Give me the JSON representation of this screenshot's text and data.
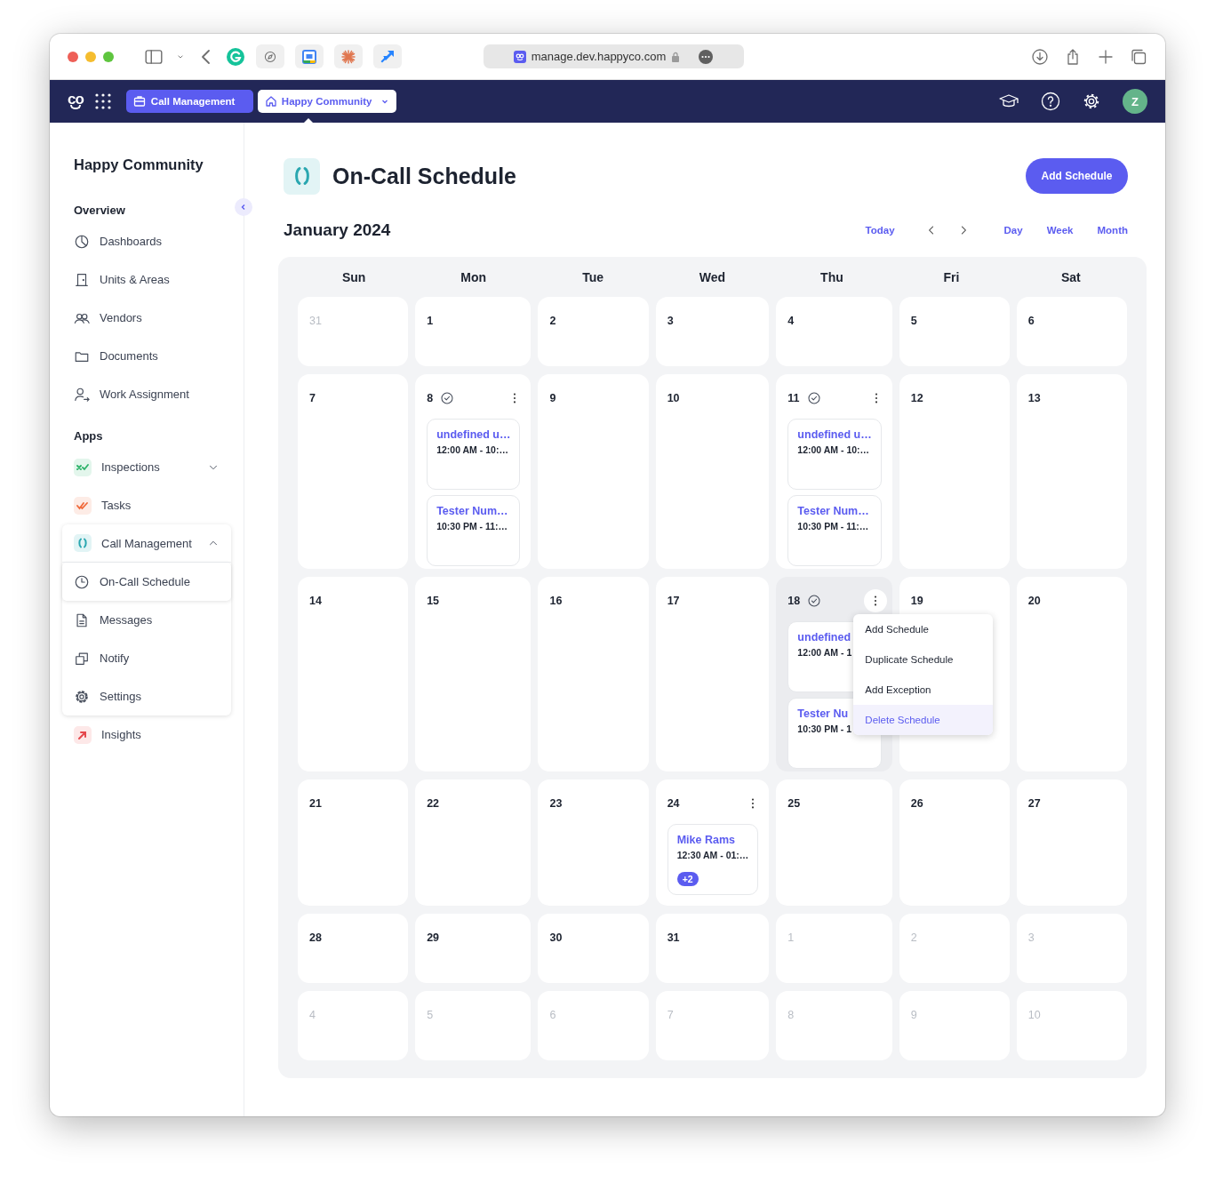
{
  "browser": {
    "url": "manage.dev.happyco.com"
  },
  "app_bar": {
    "logo": "co",
    "module": "Call Management",
    "property": "Happy Community",
    "avatar": "Z"
  },
  "sidebar": {
    "title": "Happy Community",
    "sections": [
      {
        "heading": "Overview",
        "items": [
          {
            "label": "Dashboards",
            "selected": false
          },
          {
            "label": "Units & Areas",
            "selected": false
          },
          {
            "label": "Vendors",
            "selected": false
          },
          {
            "label": "Documents",
            "selected": false
          },
          {
            "label": "Work Assignment",
            "selected": false
          }
        ]
      },
      {
        "heading": "Apps",
        "items": [
          {
            "label": "Inspections",
            "selected": false,
            "expanded": false
          },
          {
            "label": "Tasks",
            "selected": false
          },
          {
            "label": "Call Management",
            "selected": false,
            "expanded": true,
            "children": [
              {
                "label": "On-Call Schedule",
                "selected": true
              },
              {
                "label": "Messages",
                "selected": false
              },
              {
                "label": "Notify",
                "selected": false
              },
              {
                "label": "Settings",
                "selected": false
              }
            ]
          },
          {
            "label": "Insights",
            "selected": false
          }
        ]
      }
    ]
  },
  "page": {
    "title": "On-Call Schedule",
    "add_button": "Add Schedule"
  },
  "calendar": {
    "month": "January 2024",
    "today": "Today",
    "views": [
      "Day",
      "Week",
      "Month"
    ],
    "weekdays": [
      "Sun",
      "Mon",
      "Tue",
      "Wed",
      "Thu",
      "Fri",
      "Sat"
    ],
    "weeks": [
      [
        {
          "day": "31",
          "muted": true,
          "confirmed": false,
          "menu": false,
          "menu_open": false
        },
        {
          "day": "1",
          "muted": false,
          "confirmed": false,
          "menu": false,
          "menu_open": false
        },
        {
          "day": "2",
          "muted": false,
          "confirmed": false,
          "menu": false,
          "menu_open": false
        },
        {
          "day": "3",
          "muted": false,
          "confirmed": false,
          "menu": false,
          "menu_open": false
        },
        {
          "day": "4",
          "muted": false,
          "confirmed": false,
          "menu": false,
          "menu_open": false
        },
        {
          "day": "5",
          "muted": false,
          "confirmed": false,
          "menu": false,
          "menu_open": false
        },
        {
          "day": "6",
          "muted": false,
          "confirmed": false,
          "menu": false,
          "menu_open": false
        }
      ],
      [
        {
          "day": "7",
          "muted": false,
          "confirmed": false,
          "menu": false,
          "menu_open": false
        },
        {
          "day": "8",
          "muted": false,
          "confirmed": true,
          "menu": true,
          "menu_open": false,
          "events": [
            {
              "title": "undefined u…",
              "time": "12:00 AM - 10:…"
            },
            {
              "title": "Tester Num…",
              "time": "10:30 PM - 11:…"
            }
          ]
        },
        {
          "day": "9",
          "muted": false,
          "confirmed": false,
          "menu": false,
          "menu_open": false
        },
        {
          "day": "10",
          "muted": false,
          "confirmed": false,
          "menu": false,
          "menu_open": false
        },
        {
          "day": "11",
          "muted": false,
          "confirmed": true,
          "menu": true,
          "menu_open": false,
          "events": [
            {
              "title": "undefined u…",
              "time": "12:00 AM - 10:…"
            },
            {
              "title": "Tester Num…",
              "time": "10:30 PM - 11:…"
            }
          ]
        },
        {
          "day": "12",
          "muted": false,
          "confirmed": false,
          "menu": false,
          "menu_open": false
        },
        {
          "day": "13",
          "muted": false,
          "confirmed": false,
          "menu": false,
          "menu_open": false
        }
      ],
      [
        {
          "day": "14",
          "muted": false,
          "confirmed": false,
          "menu": false,
          "menu_open": false
        },
        {
          "day": "15",
          "muted": false,
          "confirmed": false,
          "menu": false,
          "menu_open": false
        },
        {
          "day": "16",
          "muted": false,
          "confirmed": false,
          "menu": false,
          "menu_open": false
        },
        {
          "day": "17",
          "muted": false,
          "confirmed": false,
          "menu": false,
          "menu_open": false
        },
        {
          "day": "18",
          "muted": false,
          "confirmed": true,
          "menu": true,
          "menu_open": true,
          "events": [
            {
              "title": "undefined",
              "time": "12:00 AM - 1"
            },
            {
              "title": "Tester Nu",
              "time": "10:30 PM - 1"
            }
          ],
          "menu_items": [
            {
              "label": "Add Schedule",
              "selected": false
            },
            {
              "label": "Duplicate Schedule",
              "selected": false
            },
            {
              "label": "Add Exception",
              "selected": false
            },
            {
              "label": "Delete Schedule",
              "selected": true
            }
          ]
        },
        {
          "day": "19",
          "muted": false,
          "confirmed": false,
          "menu": false,
          "menu_open": false
        },
        {
          "day": "20",
          "muted": false,
          "confirmed": false,
          "menu": false,
          "menu_open": false
        }
      ],
      [
        {
          "day": "21",
          "muted": false,
          "confirmed": false,
          "menu": false,
          "menu_open": false
        },
        {
          "day": "22",
          "muted": false,
          "confirmed": false,
          "menu": false,
          "menu_open": false
        },
        {
          "day": "23",
          "muted": false,
          "confirmed": false,
          "menu": false,
          "menu_open": false
        },
        {
          "day": "24",
          "muted": false,
          "confirmed": false,
          "menu": true,
          "menu_open": false,
          "events": [
            {
              "title": "Mike Rams",
              "time": "12:30 AM - 01:…",
              "more": "+2"
            }
          ]
        },
        {
          "day": "25",
          "muted": false,
          "confirmed": false,
          "menu": false,
          "menu_open": false
        },
        {
          "day": "26",
          "muted": false,
          "confirmed": false,
          "menu": false,
          "menu_open": false
        },
        {
          "day": "27",
          "muted": false,
          "confirmed": false,
          "menu": false,
          "menu_open": false
        }
      ],
      [
        {
          "day": "28",
          "muted": false,
          "confirmed": false,
          "menu": false,
          "menu_open": false
        },
        {
          "day": "29",
          "muted": false,
          "confirmed": false,
          "menu": false,
          "menu_open": false
        },
        {
          "day": "30",
          "muted": false,
          "confirmed": false,
          "menu": false,
          "menu_open": false
        },
        {
          "day": "31",
          "muted": false,
          "confirmed": false,
          "menu": false,
          "menu_open": false
        },
        {
          "day": "1",
          "muted": true,
          "confirmed": false,
          "menu": false,
          "menu_open": false
        },
        {
          "day": "2",
          "muted": true,
          "confirmed": false,
          "menu": false,
          "menu_open": false
        },
        {
          "day": "3",
          "muted": true,
          "confirmed": false,
          "menu": false,
          "menu_open": false
        }
      ],
      [
        {
          "day": "4",
          "muted": true,
          "confirmed": false,
          "menu": false,
          "menu_open": false
        },
        {
          "day": "5",
          "muted": true,
          "confirmed": false,
          "menu": false,
          "menu_open": false
        },
        {
          "day": "6",
          "muted": true,
          "confirmed": false,
          "menu": false,
          "menu_open": false
        },
        {
          "day": "7",
          "muted": true,
          "confirmed": false,
          "menu": false,
          "menu_open": false
        },
        {
          "day": "8",
          "muted": true,
          "confirmed": false,
          "menu": false,
          "menu_open": false
        },
        {
          "day": "9",
          "muted": true,
          "confirmed": false,
          "menu": false,
          "menu_open": false
        },
        {
          "day": "10",
          "muted": true,
          "confirmed": false,
          "menu": false,
          "menu_open": false
        }
      ]
    ]
  }
}
